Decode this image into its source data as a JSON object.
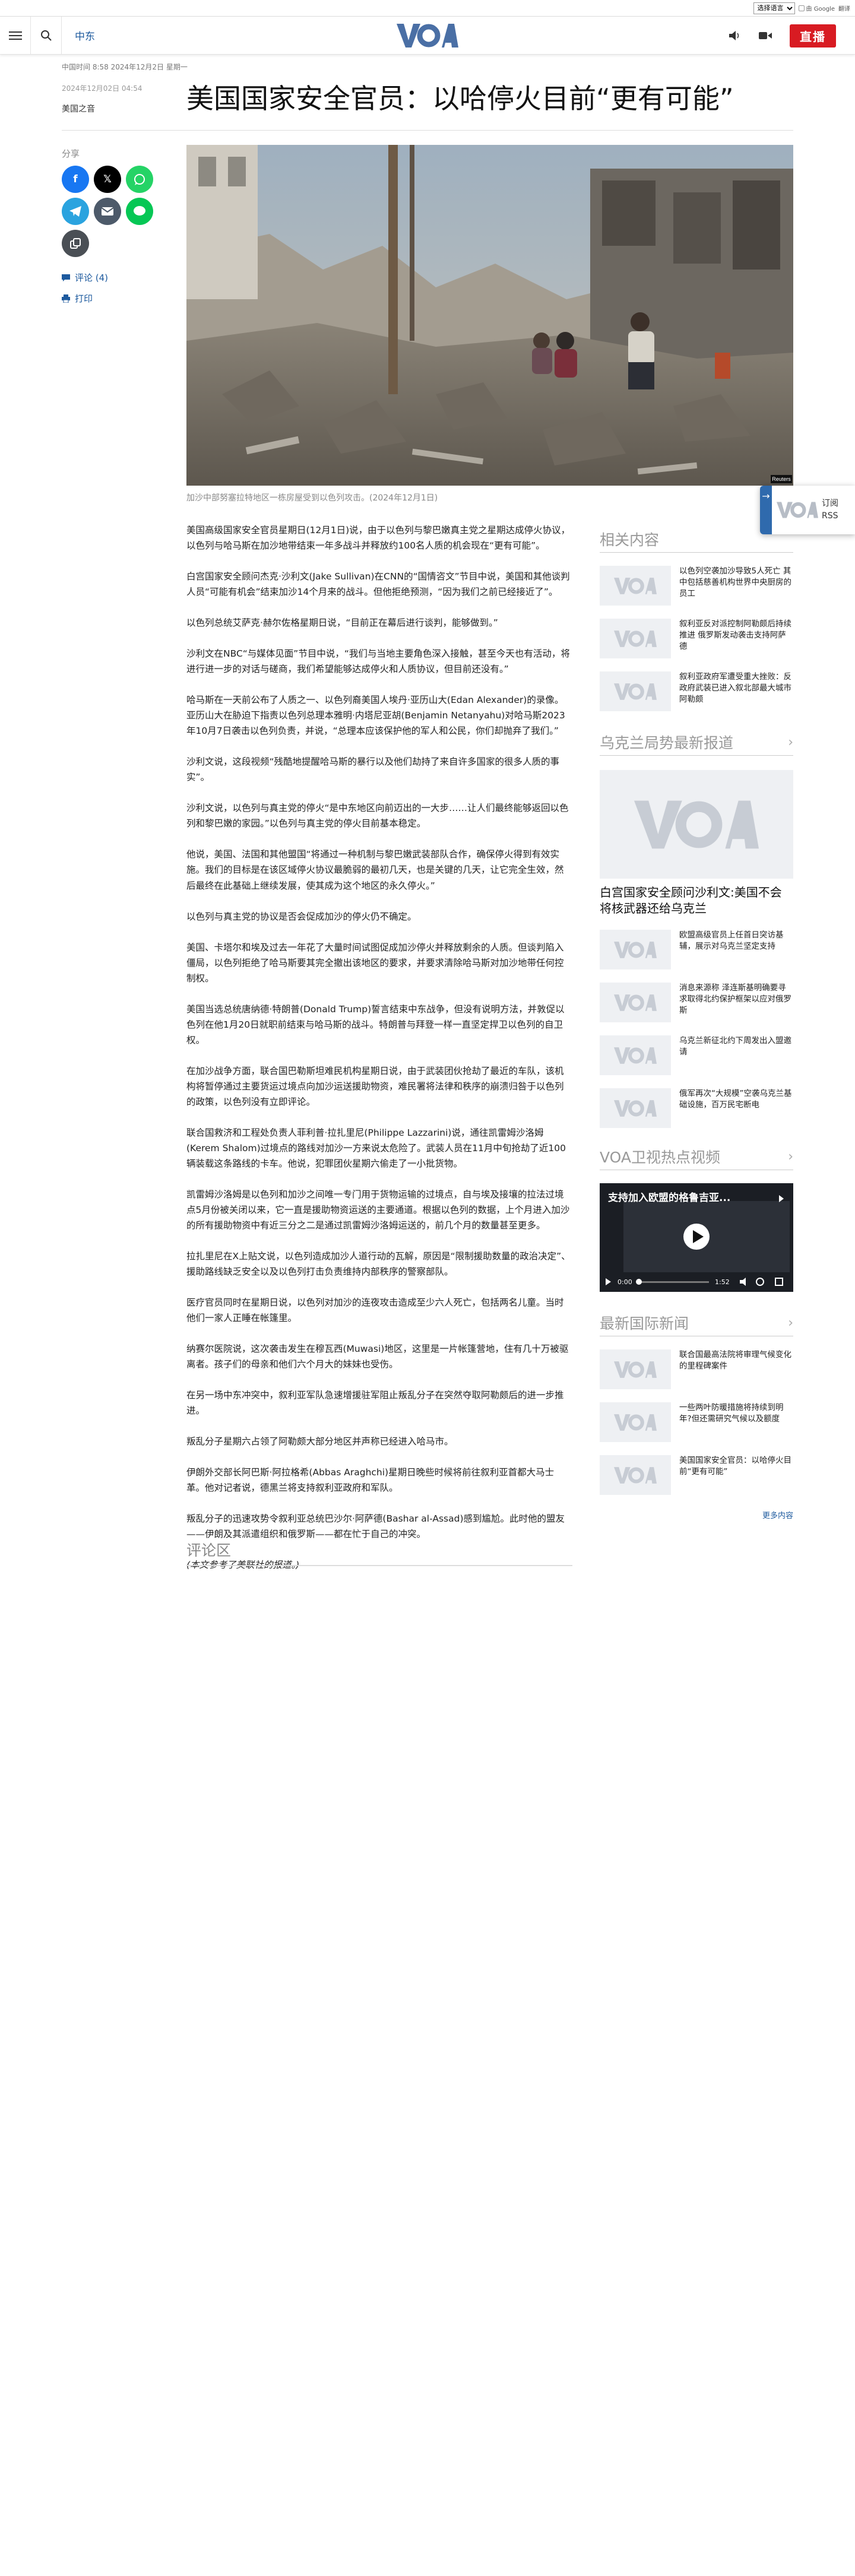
{
  "topbar": {
    "language_select": "选择语言",
    "powered": "由 Google",
    "translate": "翻译"
  },
  "header": {
    "nav_label": "中东",
    "logo": "VOA",
    "live_label": "直播"
  },
  "article": {
    "dateline": "中国时间 8:58 2024年12月2日 星期一",
    "date": "2024年12月02日 04:54",
    "source": "美国之音",
    "title": "美国国家安全官员：以哈停火目前“更有可能”",
    "share_label": "分享",
    "comments_link": "评论 (4)",
    "print_link": "打印",
    "photo_credit": "Reuters",
    "caption": "加沙中部努塞拉特地区一栋房屋受到以色列攻击。(2024年12月1日)",
    "paragraphs": [
      "美国高级国家安全官员星期日(12月1日)说，由于以色列与黎巴嫩真主党之星期达成停火协议，以色列与哈马斯在加沙地带结束一年多战斗并释放约100名人质的机会现在“更有可能”。",
      "白宫国家安全顾问杰克·沙利文(Jake Sullivan)在CNN的“国情咨文”节目中说，美国和其他谈判人员“可能有机会”结束加沙14个月来的战斗。但他拒绝预测，“因为我们之前已经接近了”。",
      "以色列总统艾萨克·赫尔佐格星期日说，“目前正在幕后进行谈判，能够做到。”",
      "沙利文在NBC“与媒体见面”节目中说，“我们与当地主要角色深入接触，甚至今天也有活动，将进行进一步的对话与磋商，我们希望能够达成停火和人质协议，但目前还没有。”",
      "哈马斯在一天前公布了人质之一、以色列裔美国人埃丹·亚历山大(Edan Alexander)的录像。亚历山大在胁迫下指责以色列总理本雅明·内塔尼亚胡(Benjamin Netanyahu)对哈马斯2023年10月7日袭击以色列负责，并说，“总理本应该保护他的军人和公民，你们却抛弃了我们。”",
      "沙利文说，这段视频“残酷地提醒哈马斯的暴行以及他们劫持了来自许多国家的很多人质的事实”。",
      "沙利文说，以色列与真主党的停火“是中东地区向前迈出的一大步……让人们最终能够返回以色列和黎巴嫩的家园。”以色列与真主党的停火目前基本稳定。",
      "他说，美国、法国和其他盟国“将通过一种机制与黎巴嫩武装部队合作，确保停火得到有效实施。我们的目标是在该区域停火协议最脆弱的最初几天，也是关键的几天，让它完全生效，然后最终在此基础上继续发展，使其成为这个地区的永久停火。”",
      "以色列与真主党的协议是否会促成加沙的停火仍不确定。",
      "美国、卡塔尔和埃及过去一年花了大量时间试图促成加沙停火并释放剩余的人质。但谈判陷入僵局，以色列拒绝了哈马斯要其完全撤出该地区的要求，并要求清除哈马斯对加沙地带任何控制权。",
      "美国当选总统唐纳德·特朗普(Donald Trump)誓言结束中东战争，但没有说明方法，并敦促以色列在他1月20日就职前结束与哈马斯的战斗。特朗普与拜登一样一直坚定捍卫以色列的自卫权。",
      "在加沙战争方面，联合国巴勒斯坦难民机构星期日说，由于武装团伙抢劫了最近的车队，该机构将暂停通过主要货运过境点向加沙运送援助物资，难民署将法律和秩序的崩溃归咎于以色列的政策，以色列没有立即评论。",
      "联合国救济和工程处负责人菲利普·拉扎里尼(Philippe Lazzarini)说，通往凯雷姆沙洛姆(Kerem Shalom)过境点的路线对加沙一方来说太危险了。武装人员在11月中旬抢劫了近100辆装载这条路线的卡车。他说，犯罪团伙星期六偷走了一小批货物。",
      "凯雷姆沙洛姆是以色列和加沙之间唯一专门用于货物运输的过境点，自与埃及接壤的拉法过境点5月份被关闭以来，它一直是援助物资运送的主要通道。根据以色列的数据，上个月进入加沙的所有援助物资中有近三分之二是通过凯雷姆沙洛姆运送的，前几个月的数量甚至更多。",
      "拉扎里尼在X上贴文说，以色列造成加沙人道行动的瓦解，原因是“限制援助数量的政治决定”、援助路线缺乏安全以及以色列打击负责维持内部秩序的警察部队。",
      "医疗官员同时在星期日说，以色列对加沙的连夜攻击造成至少六人死亡，包括两名儿童。当时他们一家人正睡在帐篷里。",
      "纳赛尔医院说，这次袭击发生在穆瓦西(Muwasi)地区，这里是一片帐篷营地，住有几十万被驱离者。孩子们的母亲和他们六个月大的妹妹也受伤。",
      "在另一场中东冲突中，叙利亚军队急速增援驻军阻止叛乱分子在突然夺取阿勒颇后的进一步推进。",
      "叛乱分子星期六占领了阿勒颇大部分地区并声称已经进入哈马市。",
      "伊朗外交部长阿巴斯·阿拉格希(Abbas Araghchi)星期日晚些时候将前往叙利亚首都大马士革。他对记者说，德黑兰将支持叙利亚政府和军队。",
      "叛乱分子的迅速攻势令叙利亚总统巴沙尔·阿萨德(Bashar al-Assad)感到尴尬。此时他的盟友——伊朗及其派遣组织和俄罗斯——都在忙于自己的冲突。"
    ],
    "note": "(本文参考了美联社的报道。)",
    "comments_heading": "评论区"
  },
  "rail": {
    "related": {
      "heading": "相关内容",
      "items": [
        "以色列空袭加沙导致5人死亡 其中包括慈善机构世界中央厨房的员工",
        "叙利亚反对派控制阿勒颇后持续推进 俄罗斯发动袭击支持阿萨德",
        "叙利亚政府军遭受重大挫败：反政府武装已进入叙北部最大城市阿勒颇"
      ]
    },
    "ukraine": {
      "heading": "乌克兰局势最新报道",
      "featured_title": "白宫国家安全顾问沙利文:美国不会将核武器还给乌克兰",
      "items": [
        "欧盟高级官员上任首日突访基辅，展示对乌克兰坚定支持",
        "消息来源称 泽连斯基明确要寻求取得北约保护框架以应对俄罗斯",
        "乌克兰新征北约下周发出入盟邀请",
        "俄军再次“大规模”空袭乌克兰基础设施，百万民宅断电"
      ]
    },
    "video": {
      "heading": "VOA卫视热点视频",
      "title": "支持加入欧盟的格鲁吉亚...",
      "time_current": "0:00",
      "time_total": "1:52"
    },
    "intl": {
      "heading": "最新国际新闻",
      "items": [
        "联合国最高法院将审理气候变化的里程碑案件",
        "一些两叶防暖措施将持续到明年?但还需研究气候以及额度",
        "美国国家安全官员：以哈停火目前“更有可能”"
      ],
      "more": "更多内容"
    }
  },
  "floater": {
    "line1": "订阅",
    "line2": "RSS"
  },
  "colors": {
    "accent": "#1d5a9e",
    "live": "#d81b22",
    "logo": "#4a6fa5"
  }
}
